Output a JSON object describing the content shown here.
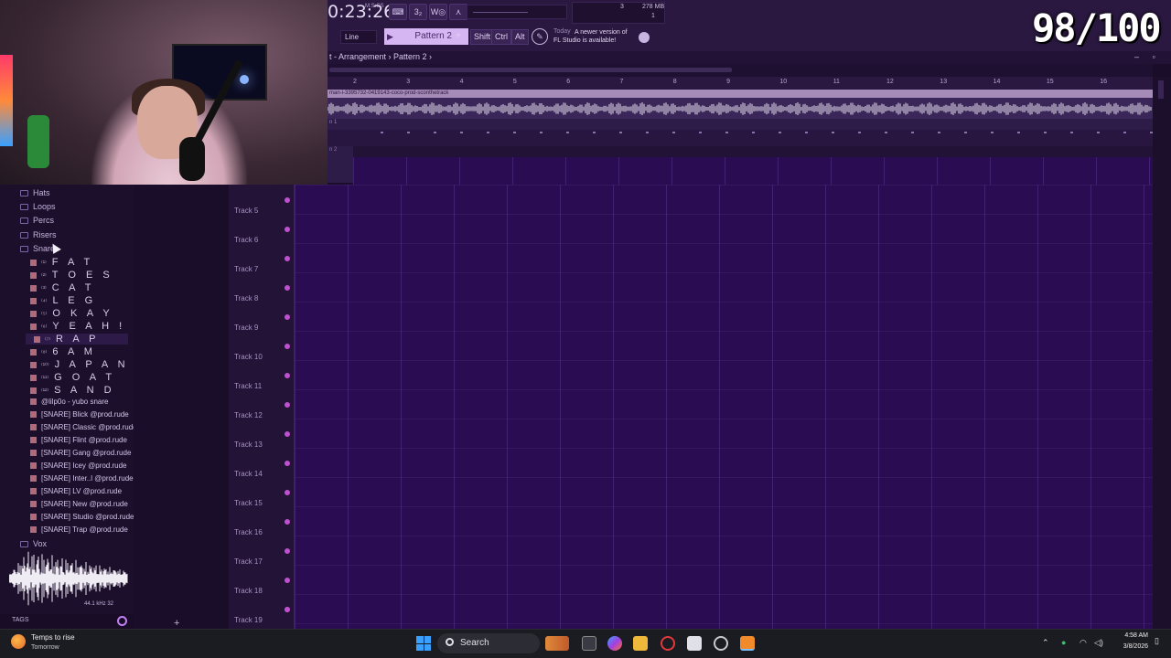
{
  "transport": {
    "time": "0:23:26",
    "time_sub": "M:S:CS",
    "cpu_value": "3",
    "memory": "278 MB",
    "poly": "1"
  },
  "toolbar": {
    "snap_value": "Line",
    "pattern_name": "Pattern 2",
    "pattern_plus": "+",
    "keys": [
      "Shift",
      "Ctrl",
      "Alt"
    ],
    "news_date": "Today",
    "news_text_line1": "A newer version of",
    "news_text_line2": "FL Studio is available!"
  },
  "score": "98/100",
  "playlist": {
    "breadcrumb": "t - Arrangement › Pattern 2 ›",
    "window_controls": "– ▫ ×",
    "ruler": [
      "2",
      "3",
      "4",
      "5",
      "6",
      "7",
      "8",
      "9",
      "10",
      "11",
      "12",
      "13",
      "14",
      "15",
      "16"
    ],
    "clip_name": "man-i-3395732-0419143-coco-prod-sconthetrack",
    "lane_label": "n 1",
    "pattern_lane_label": "n 2",
    "tracks": [
      "Track 5",
      "Track 6",
      "Track 7",
      "Track 8",
      "Track 9",
      "Track 10",
      "Track 11",
      "Track 12",
      "Track 13",
      "Track 14",
      "Track 15",
      "Track 16",
      "Track 17",
      "Track 18",
      "Track 19"
    ],
    "add_track": "+"
  },
  "browser": {
    "folders": [
      "Hats",
      "Loops",
      "Percs",
      "Risers",
      "Snare"
    ],
    "big_samples": [
      {
        "num": "⁽¹⁾",
        "name": "F A T"
      },
      {
        "num": "⁽²⁾",
        "name": "T O E S"
      },
      {
        "num": "⁽³⁾",
        "name": "C A T"
      },
      {
        "num": "⁽⁴⁾",
        "name": "L E G"
      },
      {
        "num": "⁽⁵⁾",
        "name": "O K A Y"
      },
      {
        "num": "⁽⁶⁾",
        "name": "Y E A H !"
      },
      {
        "num": "⁽⁷⁾",
        "name": "R A P"
      },
      {
        "num": "⁽⁸⁾",
        "name": "6 A M"
      },
      {
        "num": "⁽¹⁰⁾",
        "name": "J A P A N"
      },
      {
        "num": "⁽¹¹⁾",
        "name": "G O A T"
      },
      {
        "num": "⁽¹²⁾",
        "name": "S A N D"
      }
    ],
    "selected_index": 6,
    "samples": [
      "@lilp0o - yubo snare",
      "[SNARE] Blick @prod.rude",
      "[SNARE] Classic @prod.rude",
      "[SNARE] Flint @prod.rude",
      "[SNARE] Gang @prod.rude",
      "[SNARE] Icey @prod.rude",
      "[SNARE] Inter..l @prod.rude",
      "[SNARE] LV @prod.rude",
      "[SNARE] New @prod.rude",
      "[SNARE] Studio @prod.rude",
      "[SNARE] Trap @prod.rude"
    ],
    "last_folder": "Vox",
    "wave_info": "44.1 kHz 32",
    "tags_label": "TAGS"
  },
  "taskbar": {
    "weather_line1": "Temps to rise",
    "weather_line2": "Tomorrow",
    "search_label": "Search",
    "time": "4:58 AM",
    "date": "3/8/2026"
  },
  "colors": {
    "grid_bg": "#2a0c52",
    "pattern_box": "#d6b6f2",
    "track_dot": "#c050d0",
    "sample_icon": "#b06a7a"
  }
}
